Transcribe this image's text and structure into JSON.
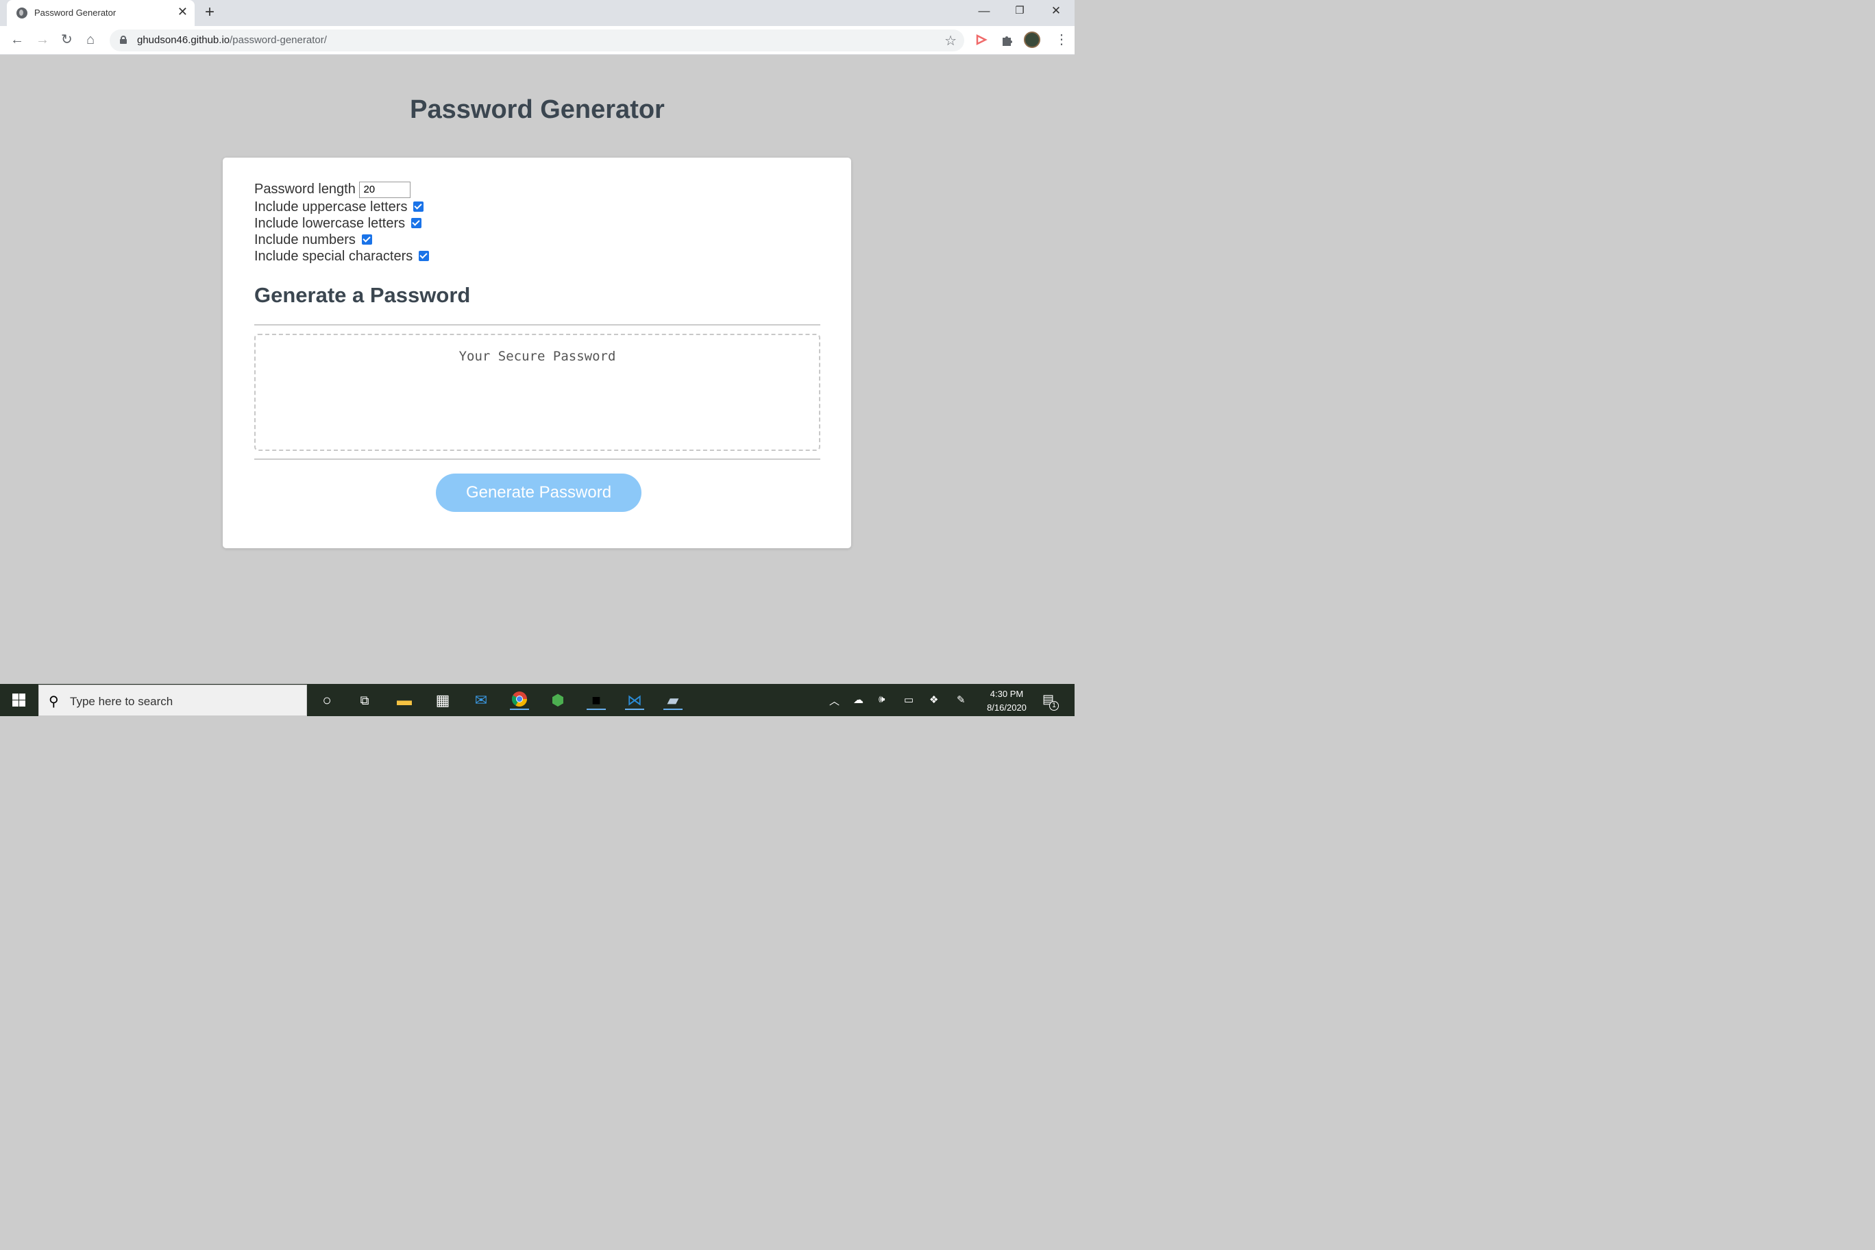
{
  "browser": {
    "tab_title": "Password Generator",
    "url_host": "ghudson46.github.io",
    "url_path": "/password-generator/"
  },
  "page": {
    "title": "Password Generator",
    "options": {
      "length_label": "Password length",
      "length_value": "20",
      "uppercase_label": "Include uppercase letters",
      "lowercase_label": "Include lowercase letters",
      "numbers_label": "Include numbers",
      "special_label": "Include special characters"
    },
    "section_heading": "Generate a Password",
    "password_placeholder": "Your Secure Password",
    "generate_button": "Generate Password"
  },
  "taskbar": {
    "search_placeholder": "Type here to search",
    "time": "4:30 PM",
    "date": "8/16/2020",
    "notification_count": "1"
  }
}
